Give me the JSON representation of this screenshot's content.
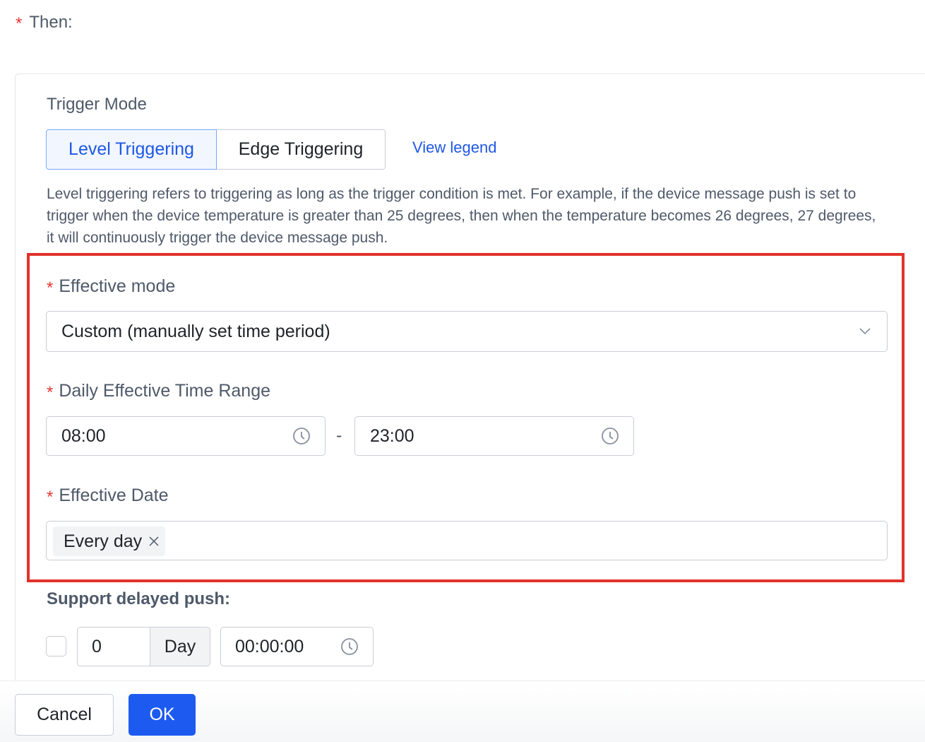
{
  "then": {
    "required_mark": "*",
    "label": "Then:"
  },
  "trigger_mode": {
    "title": "Trigger Mode",
    "options": [
      "Level Triggering",
      "Edge Triggering"
    ],
    "selected": "Level Triggering",
    "legend_link": "View legend",
    "description": "Level triggering refers to triggering as long as the trigger condition is met. For example, if the device message push is set to trigger when the device temperature is greater than 25 degrees, then when the temperature becomes 26 degrees, 27 degrees, it will continuously trigger the device message push."
  },
  "effective_mode": {
    "required_mark": "*",
    "label": "Effective mode",
    "value": "Custom (manually set time period)",
    "icon": "chevron-down-icon"
  },
  "daily_range": {
    "required_mark": "*",
    "label": "Daily Effective Time Range",
    "start": "08:00",
    "separator": "-",
    "end": "23:00",
    "icon": "clock-icon"
  },
  "effective_date": {
    "required_mark": "*",
    "label": "Effective Date",
    "tags": [
      "Every day"
    ],
    "icon": "close-icon"
  },
  "delayed_push": {
    "label": "Support delayed push:",
    "checked": false,
    "days_value": "0",
    "days_unit": "Day",
    "time_value": "00:00:00",
    "icon": "clock-icon"
  },
  "footer": {
    "cancel_label": "Cancel",
    "ok_label": "OK"
  },
  "colors": {
    "primary": "#1d5bf0",
    "required": "#e53935",
    "highlight_border": "#e0322b"
  }
}
